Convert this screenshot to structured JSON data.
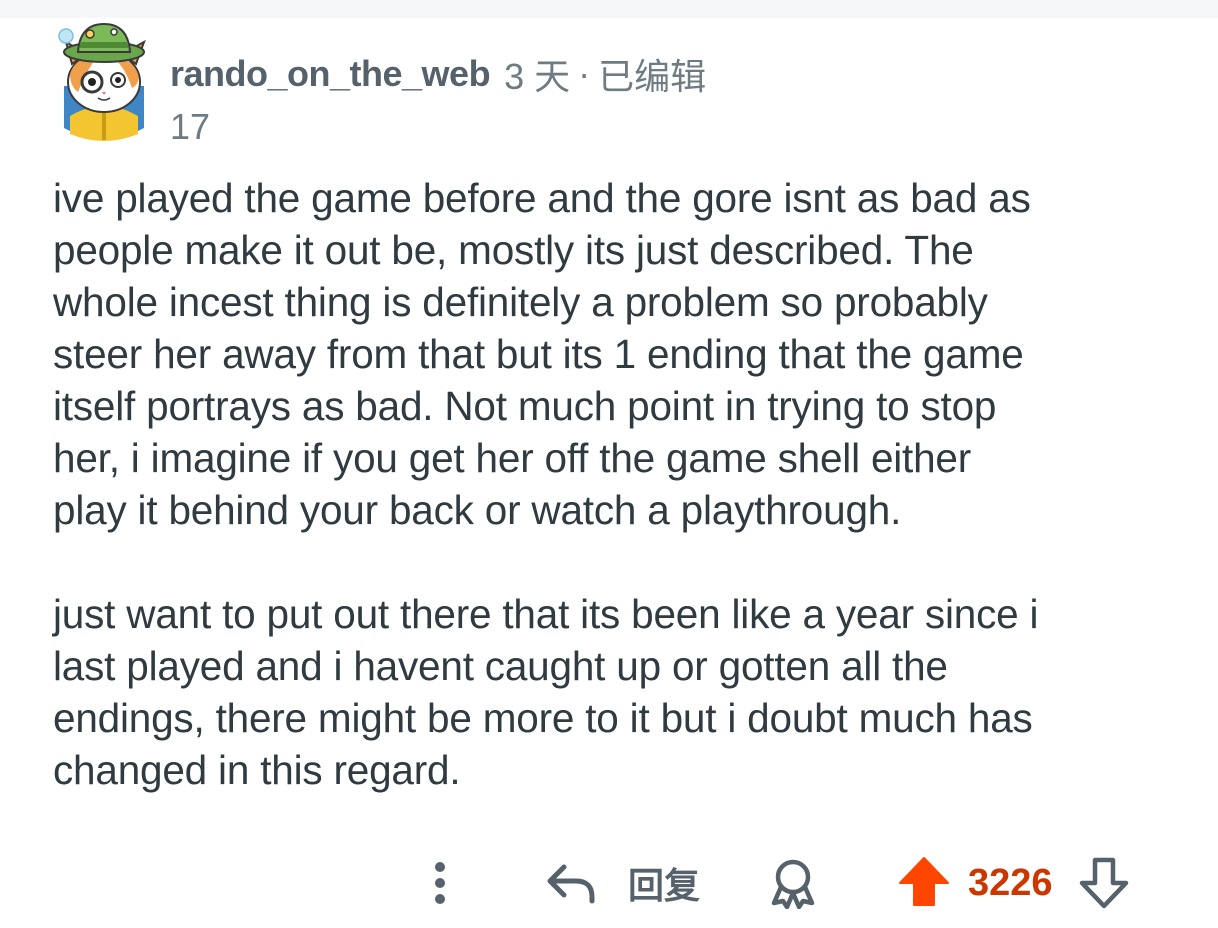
{
  "comment": {
    "username": "rando_on_the_web",
    "time": "3 天",
    "separator": "·",
    "edited": "已编辑",
    "flair": "17",
    "avatar_icon": "cat-explorer-avatar",
    "paragraphs": [
      "ive played the game before and the gore isnt as bad as\npeople make it out be, mostly its just described. The\nwhole incest thing is definitely a problem so probably\nsteer her away from that but its 1 ending that the game\nitself portrays as bad. Not much point in trying to stop\nher, i imagine if you get her off the game shell either\nplay it behind your back or watch a playthrough.",
      "just want to put out there that its been like a year since i\nlast played and i havent caught up or gotten all the\nendings, there might be more to it but i doubt much has\nchanged in this regard."
    ]
  },
  "actions": {
    "more_icon": "more-vertical-icon",
    "reply_icon": "reply-arrow-icon",
    "reply_label": "回复",
    "award_icon": "award-icon",
    "upvote_icon": "upvote-arrow-icon",
    "score": "3226",
    "downvote_icon": "downvote-arrow-icon"
  },
  "colors": {
    "text": "#2f3a41",
    "meta": "#6e7b83",
    "upvoted": "#ff4500",
    "score": "#cc3700"
  }
}
